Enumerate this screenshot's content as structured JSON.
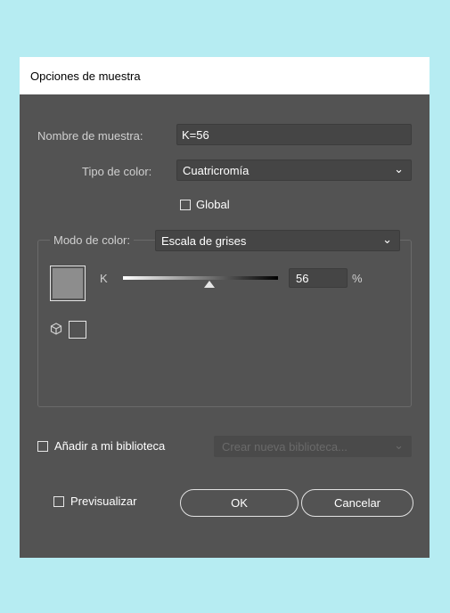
{
  "dialog": {
    "title": "Opciones de muestra",
    "swatch_name": {
      "label": "Nombre de muestra:",
      "value": "K=56"
    },
    "color_type": {
      "label": "Tipo de color:",
      "value": "Cuatricromía",
      "chevron": "⌄"
    },
    "global": {
      "label": "Global",
      "checked": false
    },
    "color_mode": {
      "label": "Modo de color:",
      "value": "Escala de grises",
      "chevron": "⌄"
    },
    "channel": {
      "letter": "K",
      "value": "56",
      "unit": "%",
      "level_percent": 56
    },
    "swatch_preview_color": "#8d8d8d",
    "out_of_gamut_icon": "cube-icon",
    "add_library": {
      "label": "Añadir a mi biblioteca",
      "checked": false
    },
    "library_select": {
      "value": "Crear nueva biblioteca...",
      "chevron": "⌄"
    },
    "preview": {
      "label": "Previsualizar",
      "checked": false
    },
    "ok_label": "OK",
    "cancel_label": "Cancelar"
  },
  "colors": {
    "background": "#b6ecf2",
    "dialog_bg": "#535353",
    "field_bg": "#454545"
  }
}
